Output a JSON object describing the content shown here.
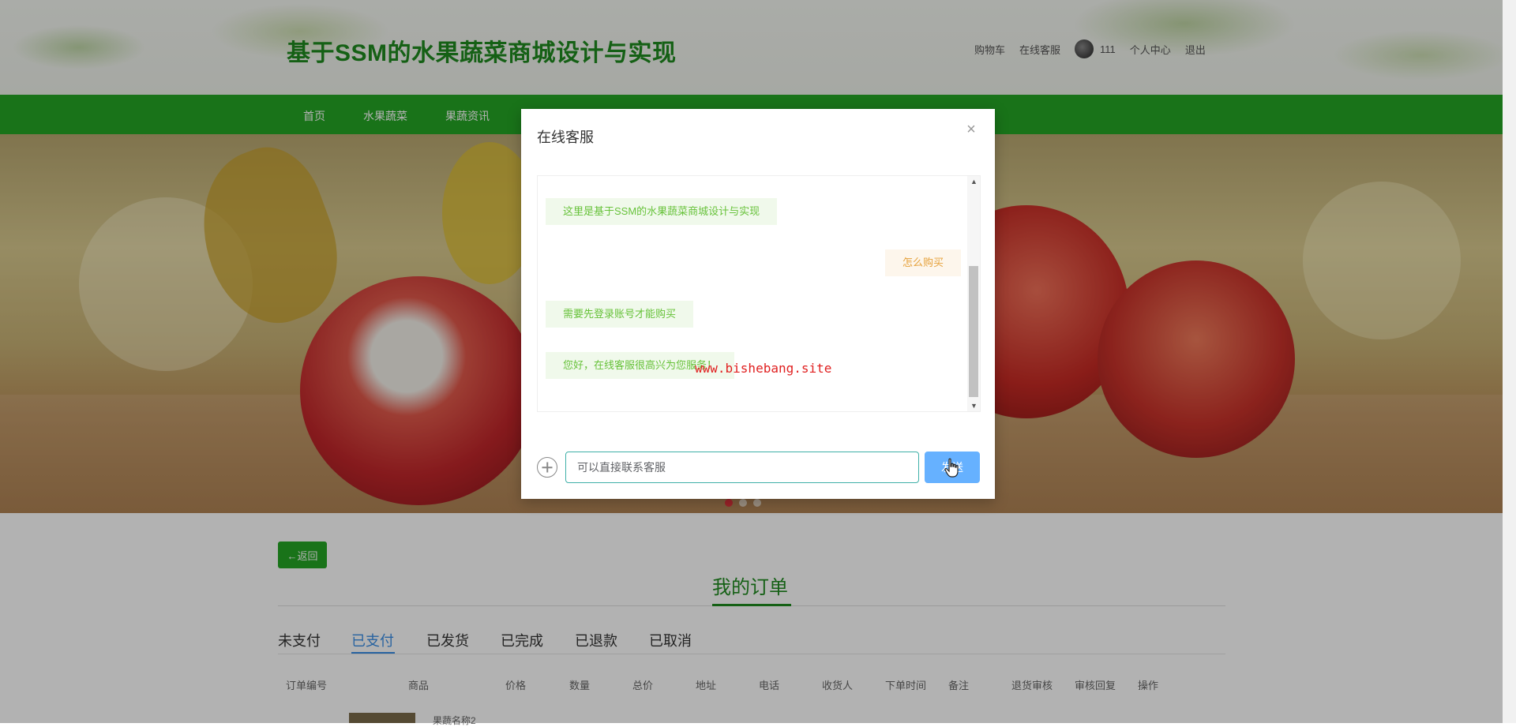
{
  "header": {
    "site_title": "基于SSM的水果蔬菜商城设计与实现",
    "links": {
      "cart": "购物车",
      "service": "在线客服",
      "username": "111",
      "profile": "个人中心",
      "logout": "退出"
    }
  },
  "nav": {
    "items": [
      "首页",
      "水果蔬菜",
      "果蔬资讯"
    ]
  },
  "page": {
    "back_label": "←返回",
    "orders_title": "我的订单",
    "status_tabs": [
      "未支付",
      "已支付",
      "已发货",
      "已完成",
      "已退款",
      "已取消"
    ],
    "active_tab": "已支付",
    "table_headers": [
      "订单编号",
      "商品",
      "价格",
      "数量",
      "总价",
      "地址",
      "电话",
      "收货人",
      "下单时间",
      "备注",
      "退货审核",
      "审核回复",
      "操作"
    ],
    "row_name": "果蔬名称2"
  },
  "dialog": {
    "title": "在线客服",
    "messages": [
      {
        "side": "left",
        "text": "这里是基于SSM的水果蔬菜商城设计与实现"
      },
      {
        "side": "right",
        "text": "怎么购买"
      },
      {
        "side": "left",
        "text": "需要先登录账号才能购买"
      },
      {
        "side": "left",
        "text": "您好，在线客服很高兴为您服务！"
      }
    ],
    "input_value": "可以直接联系客服",
    "send_label": "发送"
  },
  "watermark": "www.bishebang.site",
  "colors": {
    "brand_green": "#24a524",
    "title_green": "#1f8a1f",
    "send_blue": "#66b1ff",
    "active_tab": "#3a8ee6"
  }
}
